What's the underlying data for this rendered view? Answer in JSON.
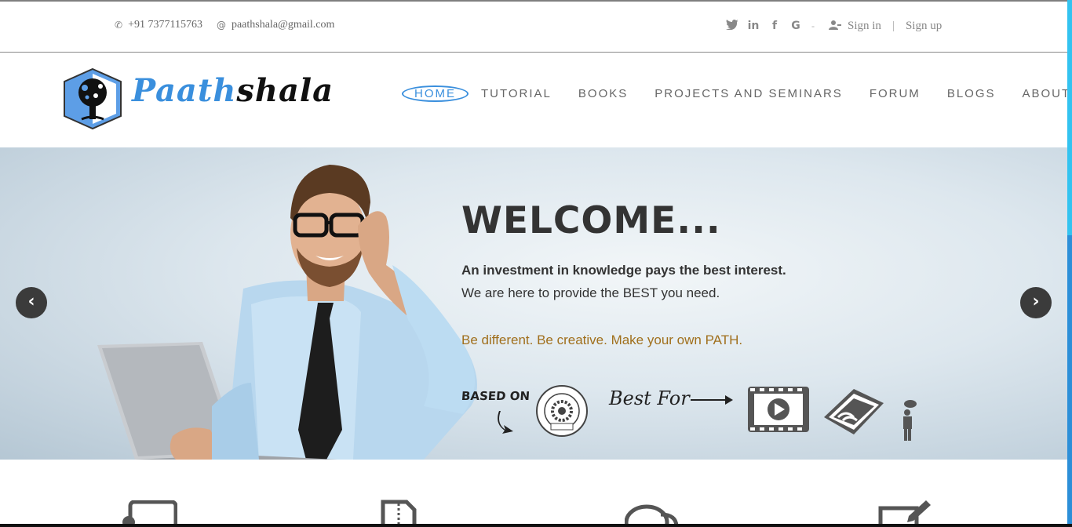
{
  "topbar": {
    "phone": "+91 7377115763",
    "email": "paathshala@gmail.com",
    "signin": "Sign in",
    "signup": "Sign up",
    "separator": "|",
    "dash": "-",
    "social_icons": [
      "twitter-icon",
      "linkedin-icon",
      "facebook-icon",
      "google-icon"
    ]
  },
  "brand": {
    "logo_part1": "Paath",
    "logo_part2": "shala",
    "accent_color": "#3a8fdd"
  },
  "nav": {
    "items": [
      {
        "label": "HOME",
        "active": true
      },
      {
        "label": "TUTORIAL"
      },
      {
        "label": "BOOKS"
      },
      {
        "label": "PROJECTS AND SEMINARS"
      },
      {
        "label": "FORUM"
      },
      {
        "label": "BLOGS"
      },
      {
        "label": "ABOUT"
      }
    ]
  },
  "hero": {
    "title": "WELCOME...",
    "line1": "An investment in knowledge pays the best interest.",
    "line2": "We are here to provide the BEST you need.",
    "line3": "Be different. Be creative. Make your own PATH.",
    "based_on": "BASED ON",
    "best_for": "Best For",
    "seal_text": "BIJU PATNAIK UNIVERSITY OF TECHNOLOGY ODISHA",
    "highlight_color": "#a06f1c"
  }
}
